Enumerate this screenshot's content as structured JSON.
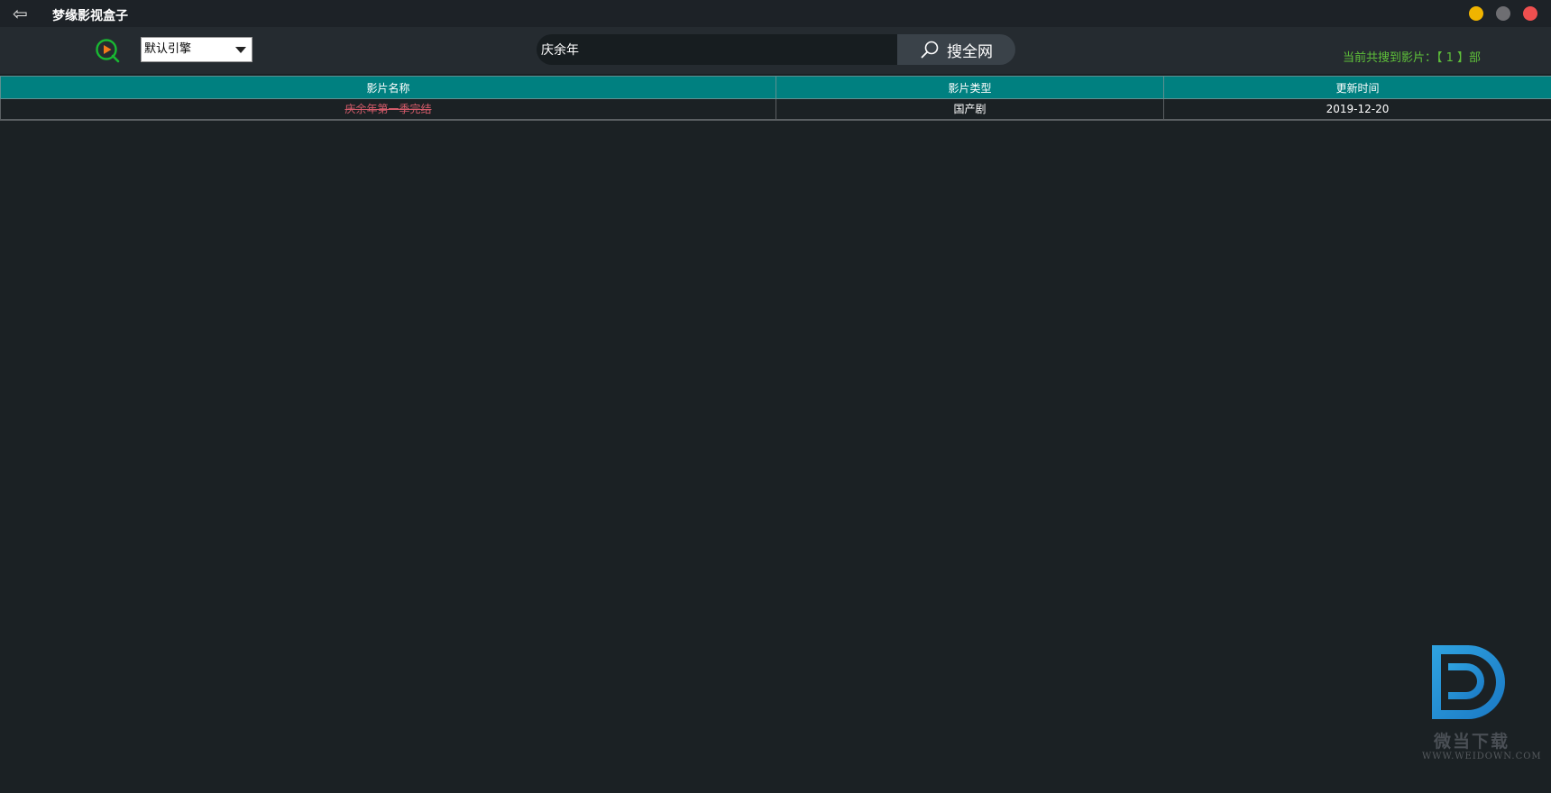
{
  "titlebar": {
    "back_icon": "arrow-left-icon",
    "title": "梦缘影视盒子",
    "buttons": {
      "minimize_color": "#f0b400",
      "maximize_color": "#6e6e72",
      "close_color": "#ee4f4f"
    }
  },
  "toolbar": {
    "logo_icon": "play-search-icon",
    "engine_select": {
      "selected": "默认引擎"
    },
    "search": {
      "value": "庆余年",
      "button_label": "搜全网",
      "button_icon": "search-icon"
    },
    "result_count": "当前共搜到影片：【 1 】部"
  },
  "table": {
    "headers": [
      "影片名称",
      "影片类型",
      "更新时间"
    ],
    "rows": [
      {
        "name": "庆余年第一季完结",
        "type": "国产剧",
        "time": "2019-12-20"
      }
    ]
  },
  "watermark": {
    "text": "微当下载",
    "url": "WWW.WEIDOWN.COM"
  },
  "colors": {
    "accent": "#008080",
    "background": "#1b2124",
    "result_text": "#5fc13a",
    "row_name": "#d45b6a"
  }
}
